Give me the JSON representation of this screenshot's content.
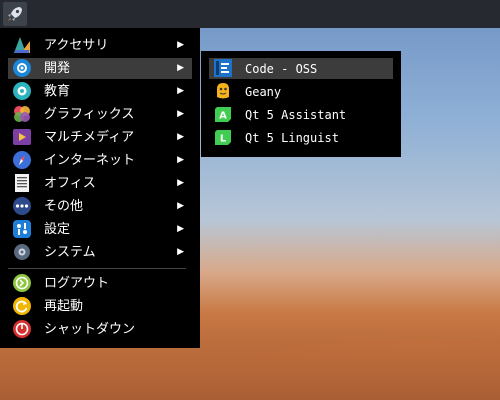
{
  "menu": {
    "items": [
      {
        "label": "アクセサリ",
        "icon": "accessories-icon"
      },
      {
        "label": "開発",
        "icon": "development-icon"
      },
      {
        "label": "教育",
        "icon": "education-icon"
      },
      {
        "label": "グラフィックス",
        "icon": "graphics-icon"
      },
      {
        "label": "マルチメディア",
        "icon": "multimedia-icon"
      },
      {
        "label": "インターネット",
        "icon": "internet-icon"
      },
      {
        "label": "オフィス",
        "icon": "office-icon"
      },
      {
        "label": "その他",
        "icon": "other-icon"
      },
      {
        "label": "設定",
        "icon": "settings-icon"
      },
      {
        "label": "システム",
        "icon": "system-icon"
      }
    ],
    "actions": [
      {
        "label": "ログアウト",
        "icon": "logout-icon"
      },
      {
        "label": "再起動",
        "icon": "reboot-icon"
      },
      {
        "label": "シャットダウン",
        "icon": "shutdown-icon"
      }
    ]
  },
  "submenu": {
    "items": [
      {
        "label": "Code - OSS",
        "icon": "code-oss-icon"
      },
      {
        "label": "Geany",
        "icon": "geany-icon"
      },
      {
        "label": "Qt 5 Assistant",
        "icon": "qt-assistant-icon"
      },
      {
        "label": "Qt 5 Linguist",
        "icon": "qt-linguist-icon"
      }
    ]
  },
  "colors": {
    "menu_bg": "#000000",
    "highlight": "#3c3c3c",
    "panel": "#262a30"
  }
}
